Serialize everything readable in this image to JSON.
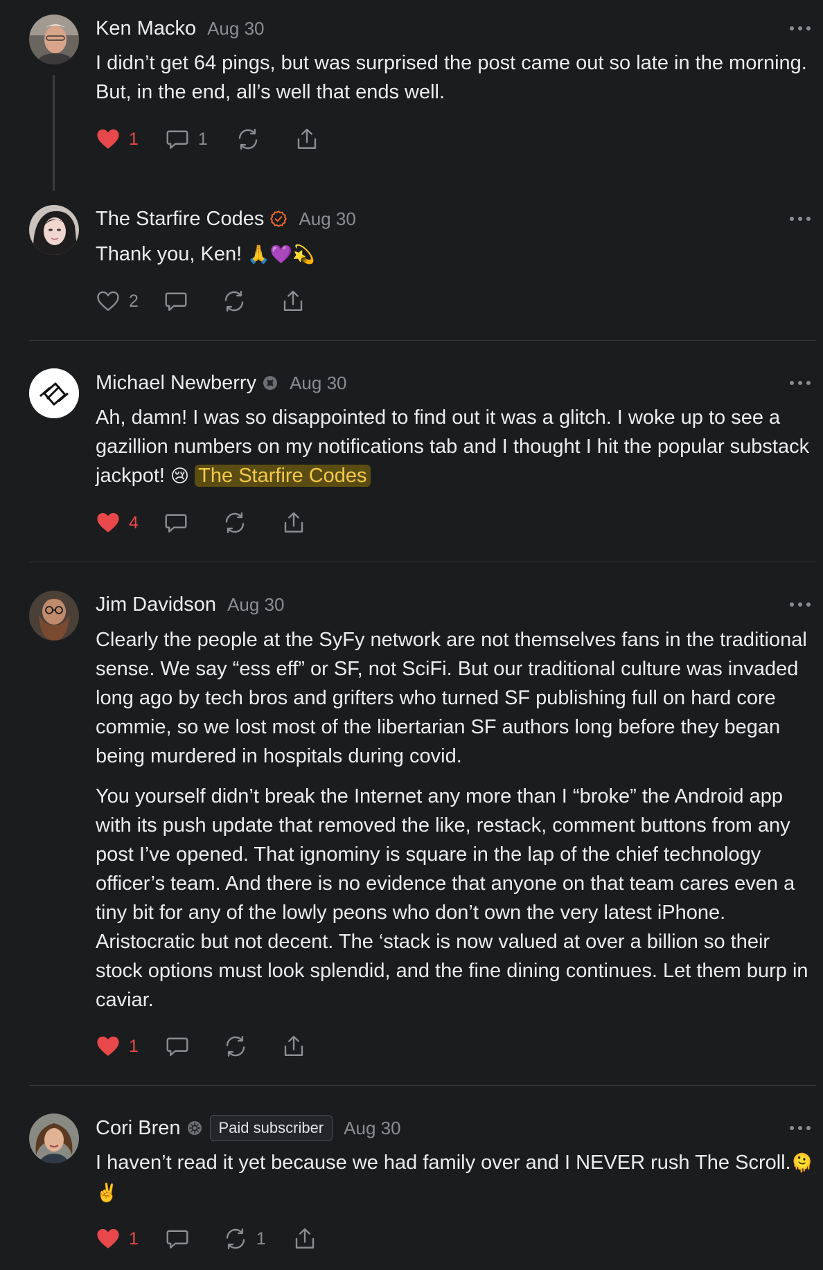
{
  "comments": [
    {
      "author": "Ken Macko",
      "date": "Aug 30",
      "body": [
        "I didn’t get 64 pings, but was surprised the post came out so late in the morning. But, in the end, all’s well that ends well."
      ],
      "likes": "1",
      "liked": true,
      "replies": "1",
      "restacks": ""
    },
    {
      "author": "The Starfire Codes",
      "date": "Aug 30",
      "body_text": "Thank you, Ken! ",
      "body_emoji": "🙏💜💫",
      "likes": "2",
      "liked": false,
      "replies": "",
      "restacks": ""
    },
    {
      "author": "Michael Newberry",
      "date": "Aug 30",
      "body_text": "Ah, damn! I was so disappointed to find out it was a glitch. I woke up to see a gazillion numbers on my notifications tab and I thought I hit the popular substack jackpot! ",
      "body_emoji": "😢",
      "mention": "The Starfire Codes",
      "likes": "4",
      "liked": true,
      "replies": "",
      "restacks": ""
    },
    {
      "author": "Jim Davidson",
      "date": "Aug 30",
      "body": [
        "Clearly the people at the SyFy network are not themselves fans in the traditional sense. We say “ess eff” or SF, not SciFi. But our traditional culture was invaded long ago by tech bros and grifters who turned SF publishing full on hard core commie, so we lost most of the libertarian SF authors long before they began being murdered in hospitals during covid.",
        "You yourself didn’t break the Internet any more than I “broke” the Android app with its push update that removed the like, restack, comment buttons from any post I’ve opened. That ignominy is square in the lap of the chief technology officer’s team. And there is no evidence that anyone on that team cares even a tiny bit for any of the lowly peons who don’t own the very latest iPhone. Aristocratic but not decent. The ‘stack is now valued at over a billion so their stock options must look splendid, and the fine dining continues. Let them burp in caviar."
      ],
      "likes": "1",
      "liked": true,
      "replies": "",
      "restacks": ""
    },
    {
      "author": "Cori Bren",
      "badge": "Paid subscriber",
      "date": "Aug 30",
      "body_text": "I haven’t read it yet because we had family over and I NEVER rush The Scroll.",
      "body_emoji": "🫠✌️",
      "likes": "1",
      "liked": true,
      "replies": "",
      "restacks": "1"
    }
  ],
  "colors": {
    "background": "#1b1c1e",
    "text": "#ececee",
    "muted": "#8c8c92",
    "like_red": "#e8484a",
    "verified_orange": "#f06b2b",
    "mention_bg": "#5b4d12",
    "mention_text": "#f3c94a"
  },
  "icons": [
    "heart-icon",
    "comment-icon",
    "restack-icon",
    "share-icon",
    "more-options-icon",
    "verified-icon",
    "subscriber-icon"
  ]
}
